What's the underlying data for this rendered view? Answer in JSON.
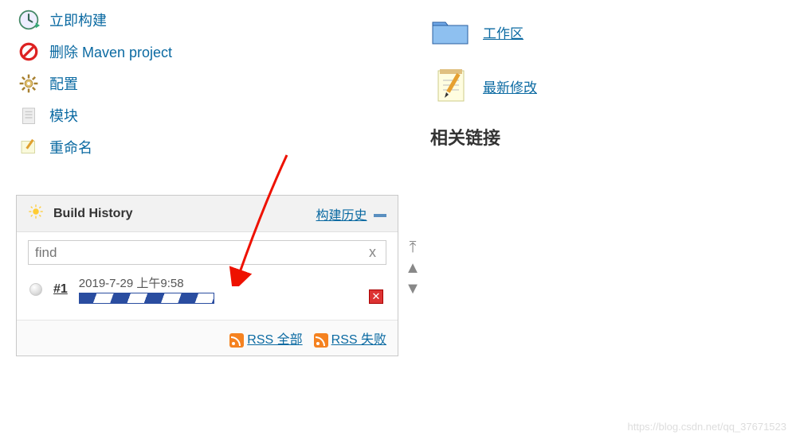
{
  "sidebar": {
    "items": [
      {
        "label": "立即构建",
        "icon": "clock-run-icon"
      },
      {
        "label": "删除 Maven project",
        "icon": "delete-icon"
      },
      {
        "label": "配置",
        "icon": "gear-icon"
      },
      {
        "label": "模块",
        "icon": "module-icon"
      },
      {
        "label": "重命名",
        "icon": "rename-icon"
      }
    ]
  },
  "right": {
    "links": [
      {
        "label": "工作区",
        "icon": "folder-icon"
      },
      {
        "label": "最新修改",
        "icon": "notepad-icon"
      }
    ],
    "section_title": "相关链接"
  },
  "build_history": {
    "title": "Build History",
    "trend_link": "构建历史",
    "find_placeholder": "find",
    "find_clear": "x",
    "builds": [
      {
        "number": "#1",
        "date": "2019-7-29 上午9:58",
        "status": "running"
      }
    ],
    "rss_all": "RSS 全部",
    "rss_failed": "RSS 失败"
  },
  "watermark": "https://blog.csdn.net/qq_37671523"
}
